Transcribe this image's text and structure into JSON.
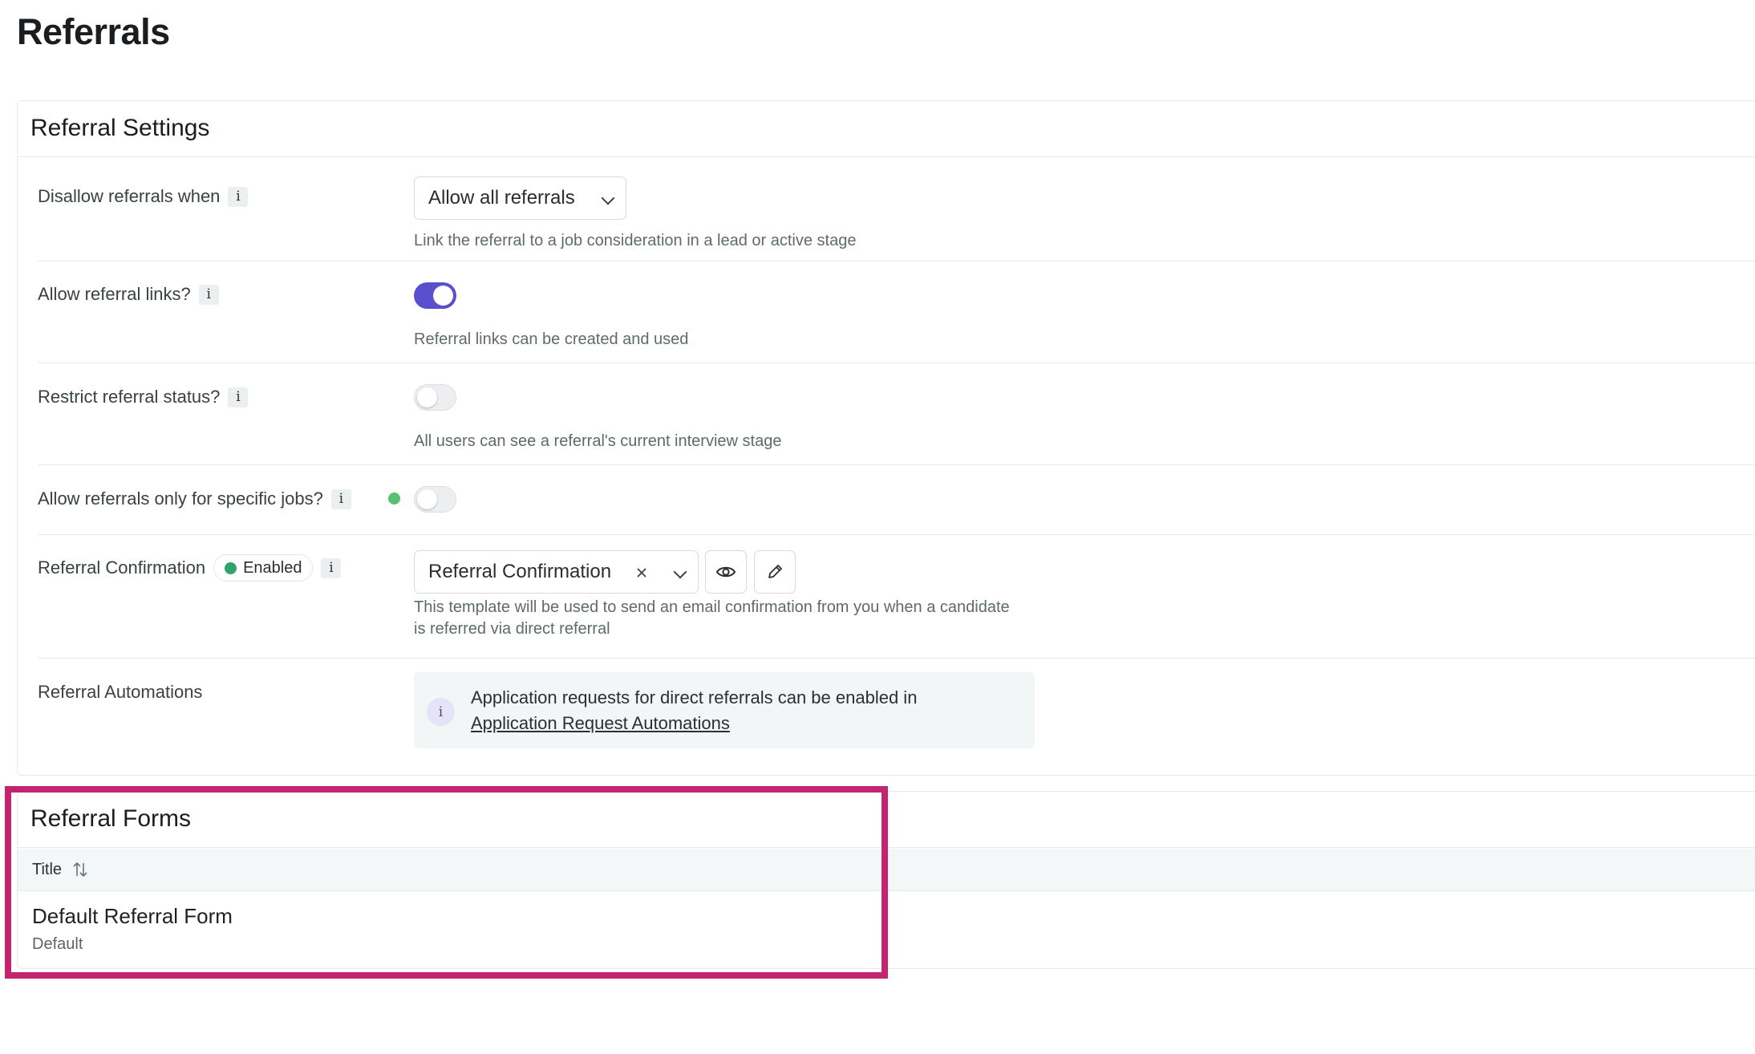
{
  "page": {
    "title": "Referrals"
  },
  "settings": {
    "title": "Referral Settings",
    "disallow": {
      "label": "Disallow referrals when",
      "value": "Allow all referrals",
      "help": "Link the referral to a job consideration in a lead or active stage"
    },
    "links": {
      "label": "Allow referral links?",
      "enabled": true,
      "help": "Referral links can be created and used"
    },
    "status": {
      "label": "Restrict referral status?",
      "enabled": false,
      "help": "All users can see a referral's current interview stage"
    },
    "specific_jobs": {
      "label": "Allow referrals only for specific jobs?",
      "enabled": false
    },
    "confirmation": {
      "label": "Referral Confirmation",
      "badge": "Enabled",
      "value": "Referral Confirmation",
      "help_line1": "This template will be used to send an email confirmation from you when a candidate",
      "help_line2": "is referred via direct referral"
    },
    "automations": {
      "label": "Referral Automations",
      "callout_text": "Application requests for direct referrals can be enabled in",
      "callout_link": "Application Request Automations"
    }
  },
  "forms": {
    "title": "Referral Forms",
    "column_title": "Title",
    "rows": [
      {
        "title": "Default Referral Form",
        "subtitle": "Default"
      }
    ]
  },
  "info_glyph": "i",
  "colors": {
    "accent": "#5b4fcf",
    "success": "#2ea36a",
    "highlight": "#c3246d"
  }
}
